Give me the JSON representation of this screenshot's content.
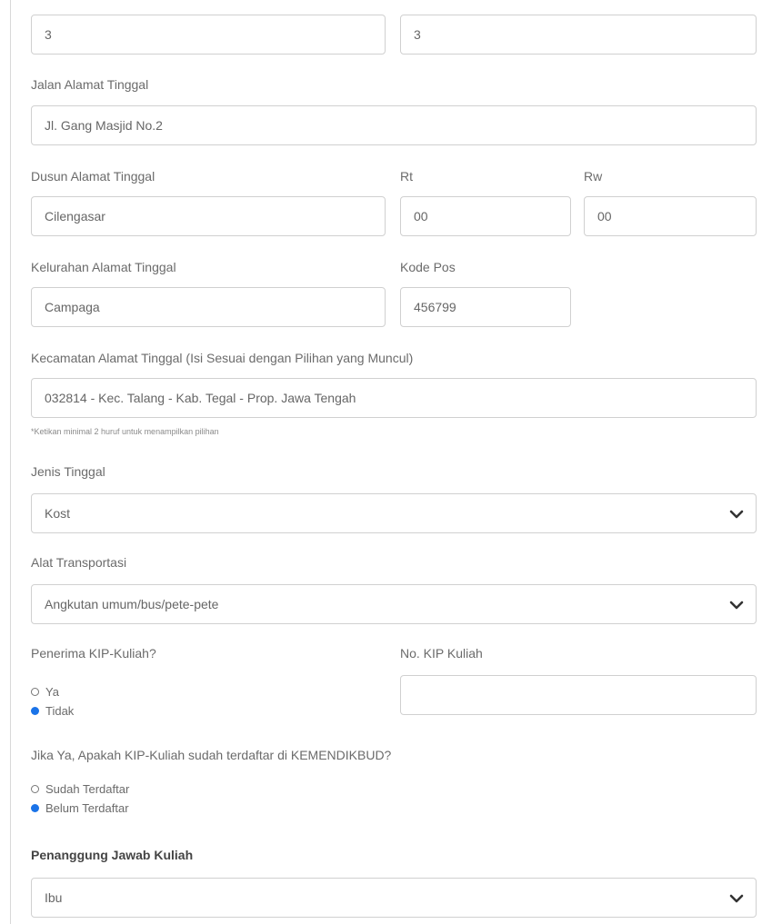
{
  "top_fields": {
    "left_value": "3",
    "right_value": "3"
  },
  "jalan": {
    "label": "Jalan Alamat Tinggal",
    "value": "Jl. Gang Masjid No.2"
  },
  "dusun": {
    "label": "Dusun Alamat Tinggal",
    "value": "Cilengasar"
  },
  "rt": {
    "label": "Rt",
    "value": "00"
  },
  "rw": {
    "label": "Rw",
    "value": "00"
  },
  "kelurahan": {
    "label": "Kelurahan Alamat Tinggal",
    "value": "Campaga"
  },
  "kode_pos": {
    "label": "Kode Pos",
    "value": "456799"
  },
  "kecamatan": {
    "label": "Kecamatan Alamat Tinggal (Isi Sesuai dengan Pilihan yang Muncul)",
    "value": "032814 - Kec. Talang - Kab. Tegal - Prop. Jawa Tengah",
    "hint": "*Ketikan minimal 2 huruf untuk menampilkan pilihan"
  },
  "jenis_tinggal": {
    "label": "Jenis Tinggal",
    "selected": "Kost"
  },
  "alat_transportasi": {
    "label": "Alat Transportasi",
    "selected": "Angkutan umum/bus/pete-pete"
  },
  "kip": {
    "label": "Penerima KIP-Kuliah?",
    "options": [
      {
        "label": "Ya",
        "checked": false
      },
      {
        "label": "Tidak",
        "checked": true
      }
    ],
    "no_label": "No. KIP Kuliah",
    "no_value": ""
  },
  "kip_terdaftar": {
    "label": "Jika Ya, Apakah KIP-Kuliah sudah terdaftar di KEMENDIKBUD?",
    "options": [
      {
        "label": "Sudah Terdaftar",
        "checked": false
      },
      {
        "label": "Belum Terdaftar",
        "checked": true
      }
    ]
  },
  "penanggung": {
    "label": "Penanggung Jawab Kuliah",
    "selected": "Ibu"
  },
  "icons": {
    "chevron": "chevron-down-icon"
  },
  "colors": {
    "radio_checked": "#1a73e8",
    "border": "#d0d0d0"
  }
}
